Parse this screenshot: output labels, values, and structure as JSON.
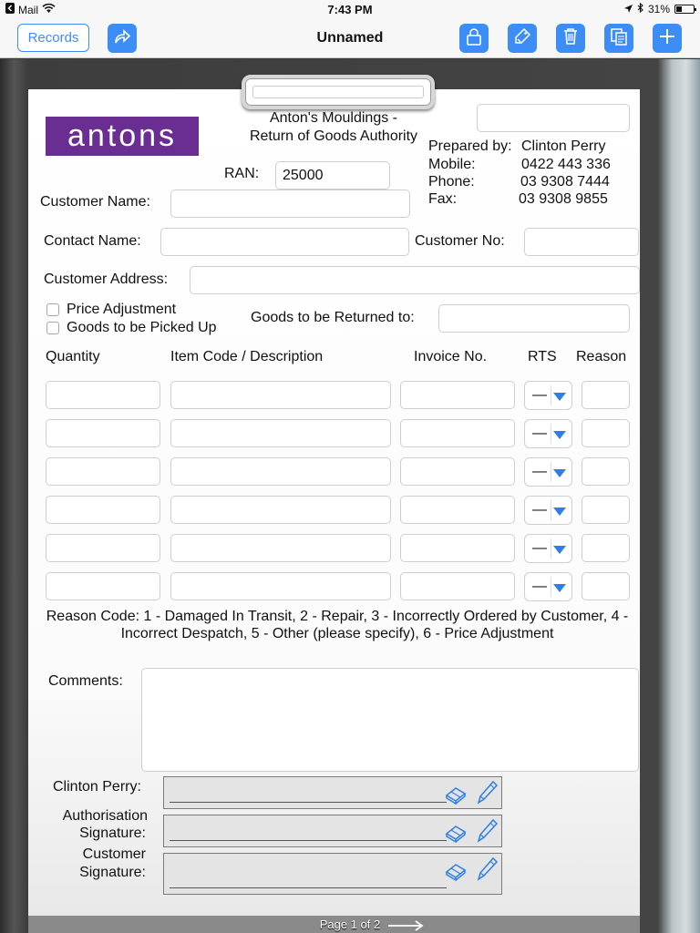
{
  "status_bar": {
    "back_app": "Mail",
    "time": "7:43 PM",
    "battery": "31%",
    "battery_level": 0.31
  },
  "nav": {
    "records_label": "Records",
    "title": "Unnamed"
  },
  "form": {
    "company_line1": "Anton's Mouldings -",
    "company_line2": "Return of Goods Authority",
    "logo_text": "antons",
    "prepared_by_label": "Prepared by:",
    "prepared_by": "Clinton Perry",
    "mobile_label": "Mobile:",
    "mobile": "0422 443 336",
    "phone_label": "Phone:",
    "phone": "03 9308 7444",
    "fax_label": "Fax:",
    "fax": "03 9308 9855",
    "ran_label": "RAN:",
    "ran_value": "25000",
    "customer_name_label": "Customer Name:",
    "contact_name_label": "Contact Name:",
    "customer_no_label": "Customer No:",
    "customer_address_label": "Customer Address:",
    "price_adjustment_label": "Price Adjustment",
    "goods_picked_up_label": "Goods to be Picked Up",
    "goods_returned_to_label": "Goods to be Returned to:",
    "columns": [
      "Quantity",
      "Item Code / Description",
      "Invoice No.",
      "RTS",
      "Reason"
    ],
    "rts_value": "—",
    "reason_code": "Reason Code: 1 - Damaged In Transit, 2 - Repair, 3 - Incorrectly Ordered by Customer, 4 - Incorrect Despatch, 5 - Other (please specify), 6 - Price Adjustment",
    "comments_label": "Comments:",
    "sig1_label": "Clinton Perry:",
    "sig2_label_line1": "Authorisation",
    "sig2_label_line2": "Signature:",
    "sig3_label_line1": "Customer",
    "sig3_label_line2": "Signature:"
  },
  "footer": {
    "page_label": "Page 1 of 2"
  },
  "colors": {
    "accent": "#3d8df6",
    "logo_bg": "#6a2d92"
  }
}
